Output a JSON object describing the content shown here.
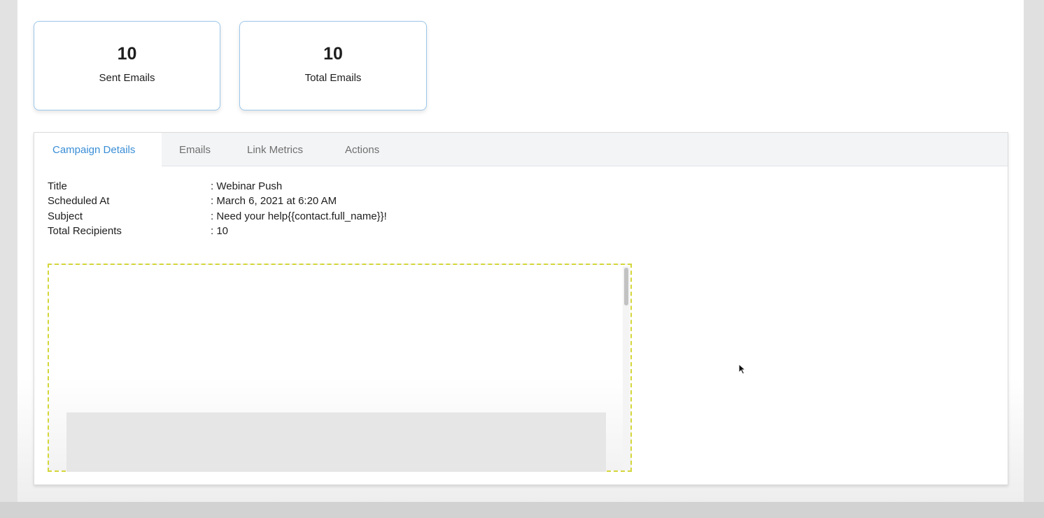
{
  "stats": {
    "sent": {
      "value": "10",
      "label": "Sent Emails"
    },
    "total": {
      "value": "10",
      "label": "Total Emails"
    }
  },
  "tabs": [
    {
      "label": "Campaign Details",
      "active": true
    },
    {
      "label": "Emails",
      "active": false
    },
    {
      "label": "Link Metrics",
      "active": false
    },
    {
      "label": "Actions",
      "active": false
    }
  ],
  "details": [
    {
      "key": "Title",
      "value": ": Webinar Push"
    },
    {
      "key": "Scheduled At",
      "value": ": March 6, 2021 at 6:20 AM"
    },
    {
      "key": "Subject",
      "value": ": Need your help{{contact.full_name}}!"
    },
    {
      "key": "Total Recipients",
      "value": ": 10"
    }
  ],
  "colors": {
    "accent": "#3a8ed6",
    "card_border": "#9cc7ea",
    "preview_border": "#d4d63a"
  }
}
